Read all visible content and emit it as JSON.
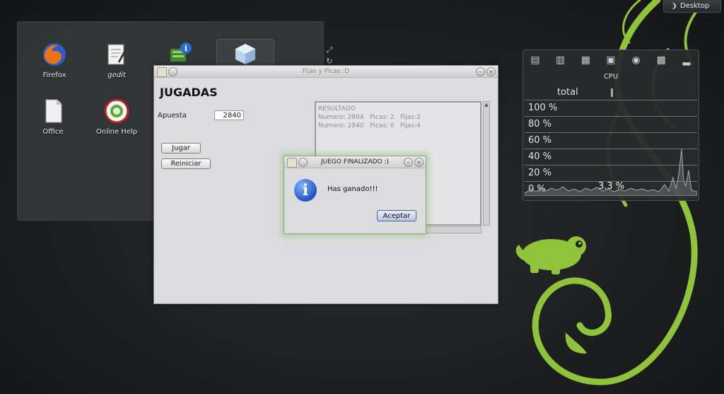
{
  "desktop": {
    "button_label": "Desktop",
    "icons": [
      {
        "label": "Firefox"
      },
      {
        "label": "gedit"
      },
      {
        "label": ""
      },
      {
        "label": ""
      },
      {
        "label": "Office"
      },
      {
        "label": "Online Help"
      }
    ]
  },
  "cpu_widget": {
    "title": "CPU",
    "total_label": "total",
    "gridlines": [
      "100 %",
      "80 %",
      "60 %",
      "40 %",
      "20 %",
      "0 %"
    ],
    "value": "3.3 %"
  },
  "main_window": {
    "title": "Fijas y Picas :D",
    "heading": "JUGADAS",
    "bet_label": "Apuesta",
    "bet_value": "2840",
    "play_button": "Jugar",
    "restart_button": "Reiniciar",
    "result_lines": [
      "RESULTADO",
      "",
      "Numero: 2804   Picas: 2   Fijas:2",
      "Numero: 2840   Picas: 0   Fijas:4"
    ]
  },
  "dialog": {
    "title": "JUEGO FINALIZADO :)",
    "message": "Has ganado!!!",
    "accept_button": "Aceptar"
  },
  "colors": {
    "swirl_green": "#8fc33a",
    "dialog_glow": "#9cc880",
    "info_blue": "#1f56c4"
  }
}
